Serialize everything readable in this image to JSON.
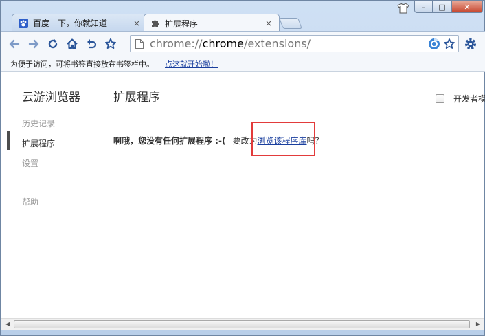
{
  "tabs": [
    {
      "title": "百度一下，你就知道",
      "icon": "paw-icon",
      "close": "×"
    },
    {
      "title": "扩展程序",
      "icon": "puzzle-icon",
      "close": "×"
    }
  ],
  "window_controls": {
    "minimize": "–",
    "maximize": "□",
    "close": "✕"
  },
  "toolbar": {
    "back_icon": "back-arrow-icon",
    "forward_icon": "forward-arrow-icon",
    "reload_icon": "reload-icon",
    "home_icon": "home-icon",
    "undo_icon": "undo-icon",
    "star_icon": "star-icon"
  },
  "omnibox": {
    "scheme": "chrome://",
    "host": "chrome",
    "path": "/extensions/"
  },
  "bookmarks_bar": {
    "hint": "为便于访问，可将书签直接放在书签栏中。",
    "link": "点这就开始啦！"
  },
  "sidebar": {
    "title": "云游浏览器",
    "items": [
      {
        "label": "历史记录"
      },
      {
        "label": "扩展程序"
      },
      {
        "label": "设置"
      },
      {
        "label": "帮助"
      }
    ]
  },
  "main": {
    "title": "扩展程序",
    "dev_mode_label": "开发者模式",
    "empty_bold": "啊哦，您没有任何扩展程序 :-(",
    "empty_question_prefix": "要改为",
    "empty_link": "浏览该程序库",
    "empty_question_suffix": "吗？"
  },
  "colors": {
    "accent_link": "#1a3f9e",
    "highlight_box": "#e23b3b",
    "frame": "#c9daee"
  }
}
